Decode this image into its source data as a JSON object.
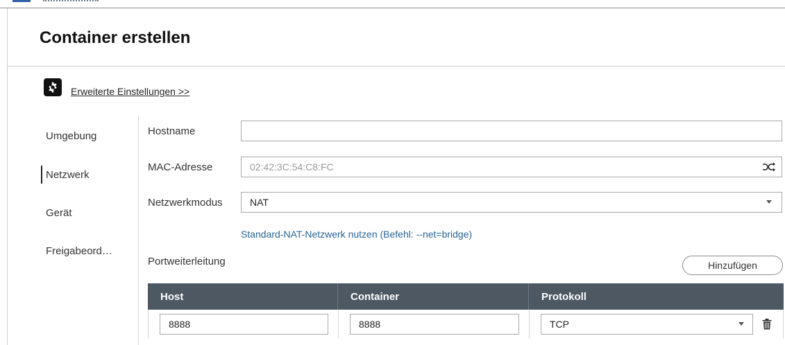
{
  "header": {
    "title": "Container erstellen"
  },
  "advanced": {
    "icon": "gear-icon",
    "link_label": "Erweiterte Einstellungen >>"
  },
  "nav": {
    "items": [
      {
        "label": "Umgebung",
        "active": false
      },
      {
        "label": "Netzwerk",
        "active": true
      },
      {
        "label": "Gerät",
        "active": false
      },
      {
        "label": "Freigabeord…",
        "active": false
      }
    ]
  },
  "form": {
    "hostname": {
      "label": "Hostname",
      "value": ""
    },
    "mac": {
      "label": "MAC-Adresse",
      "value": "02:42:3C:54:C8:FC",
      "icon": "shuffle-icon"
    },
    "network_mode": {
      "label": "Netzwerkmodus",
      "value": "NAT",
      "icon": "chevron-down-icon"
    },
    "hint": "Standard-NAT-Netzwerk nutzen (Befehl: --net=bridge)",
    "port_forwarding": {
      "label": "Portweiterleitung",
      "add_button": "Hinzufügen"
    }
  },
  "port_table": {
    "columns": [
      "Host",
      "Container",
      "Protokoll"
    ],
    "rows": [
      {
        "host": "8888",
        "container": "8888",
        "protocol": "TCP"
      }
    ],
    "row_icon": "trash-icon"
  },
  "colors": {
    "table_header": "#4d5863",
    "hint_link": "#2a6496",
    "accent": "#2f5fa6"
  }
}
